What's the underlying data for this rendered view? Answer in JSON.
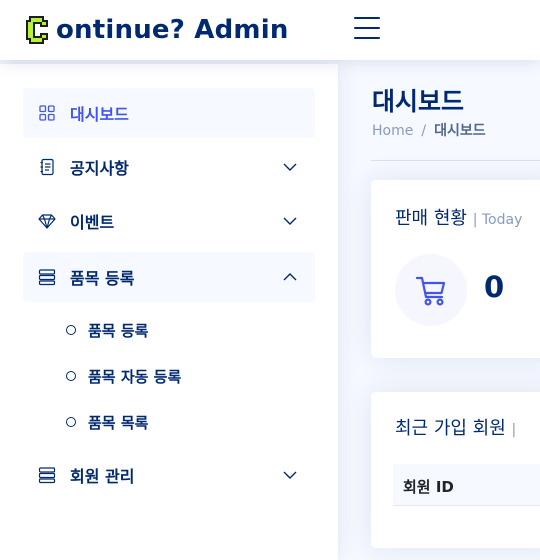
{
  "header": {
    "logo_text": "ontinue? Admin",
    "brand_color": "#012970",
    "logo_icon_color": "#b6f334"
  },
  "sidebar": {
    "items": [
      {
        "label": "대시보드",
        "icon": "grid-icon",
        "active": true
      },
      {
        "label": "공지사항",
        "icon": "journal-icon",
        "chevron": "down"
      },
      {
        "label": "이벤트",
        "icon": "gem-icon",
        "chevron": "down"
      },
      {
        "label": "품목 등록",
        "icon": "layout-icon",
        "chevron": "up",
        "expanded": true,
        "children": [
          {
            "label": "품목 등록"
          },
          {
            "label": "품목 자동 등록"
          },
          {
            "label": "품목 목록"
          }
        ]
      },
      {
        "label": "회원 관리",
        "icon": "layout-icon",
        "chevron": "down"
      }
    ]
  },
  "main": {
    "page_title": "대시보드",
    "breadcrumb": {
      "home": "Home",
      "separator": "/",
      "current": "대시보드"
    },
    "sales_card": {
      "title": "판매 현황",
      "filter": "| Today",
      "value": "0",
      "icon": "cart-icon"
    },
    "members_card": {
      "title": "최근 가입 회원",
      "filter": "|",
      "columns": [
        "회원 ID"
      ]
    }
  },
  "colors": {
    "accent": "#4154f1",
    "muted": "#899bbd",
    "background": "#f6f9ff"
  }
}
